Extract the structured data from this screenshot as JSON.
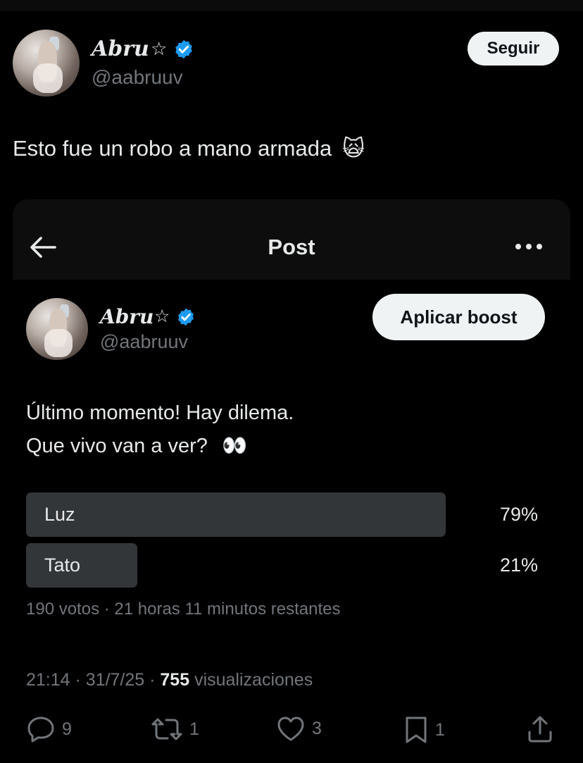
{
  "outer_tweet": {
    "display_name": "Abru",
    "star_glyph": "☆",
    "handle": "@aabruuv",
    "follow_button": "Seguir",
    "text": "Esto fue un robo a mano armada",
    "emoji": "🙀"
  },
  "embedded_post": {
    "header_title": "Post",
    "display_name": "Abru",
    "star_glyph": "☆",
    "handle": "@aabruuv",
    "boost_button": "Aplicar boost",
    "text_line1": "Último momento! Hay dilema.",
    "text_line2": "Que vivo van a ver?",
    "text_emoji": "👀",
    "poll": {
      "options": [
        {
          "label": "Luz",
          "percent_text": "79%",
          "percent": 79
        },
        {
          "label": "Tato",
          "percent_text": "21%",
          "percent": 21
        }
      ],
      "meta": "190 votos · 21 horas 11 minutos restantes"
    },
    "timestamp": "21:14 · 31/7/25 · ",
    "views_count": "755",
    "views_label": " visualizaciones",
    "actions": {
      "replies": "9",
      "reposts": "1",
      "likes": "3",
      "bookmarks": "1"
    }
  },
  "colors": {
    "background": "#000000",
    "verified_blue": "#1d9bf0",
    "muted_text": "#71767b",
    "poll_fill": "#333639"
  }
}
